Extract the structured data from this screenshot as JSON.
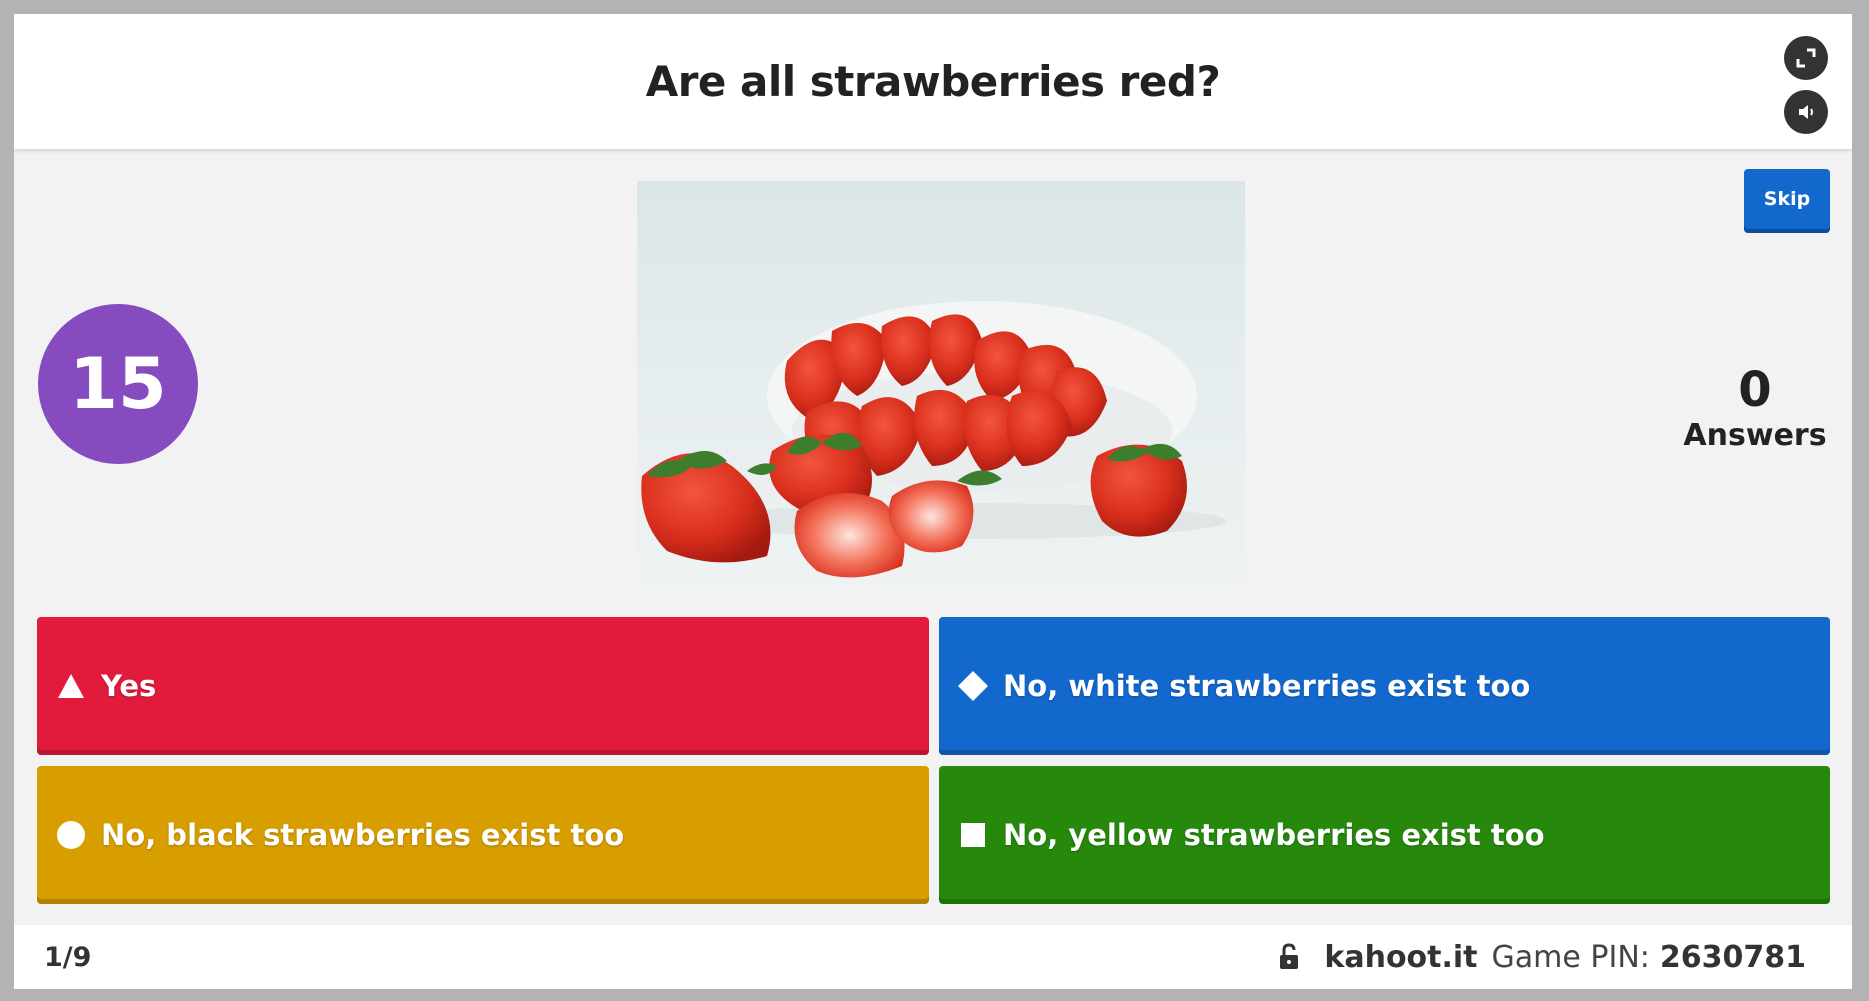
{
  "header": {
    "question": "Are all strawberries red?",
    "fullscreen_icon": "fullscreen-icon",
    "sound_icon": "sound-icon"
  },
  "controls": {
    "skip_label": "Skip"
  },
  "timer": {
    "seconds": "15"
  },
  "answers_count": {
    "value": "0",
    "label": "Answers"
  },
  "answers": [
    {
      "shape": "triangle",
      "label": "Yes",
      "color": "#e21b3c"
    },
    {
      "shape": "diamond",
      "label": "No, white strawberries exist too",
      "color": "#1368ce"
    },
    {
      "shape": "circle",
      "label": "No, black strawberries exist too",
      "color": "#d89e00"
    },
    {
      "shape": "square",
      "label": "No, yellow strawberries exist too",
      "color": "#26890c"
    }
  ],
  "footer": {
    "progress": "1/9",
    "site": "kahoot.it",
    "pin_label": "Game PIN:",
    "pin": "2630781"
  },
  "colors": {
    "timer_bg": "#864cbf",
    "skip_bg": "#1368ce",
    "stage_bg": "#f2f2f2"
  }
}
